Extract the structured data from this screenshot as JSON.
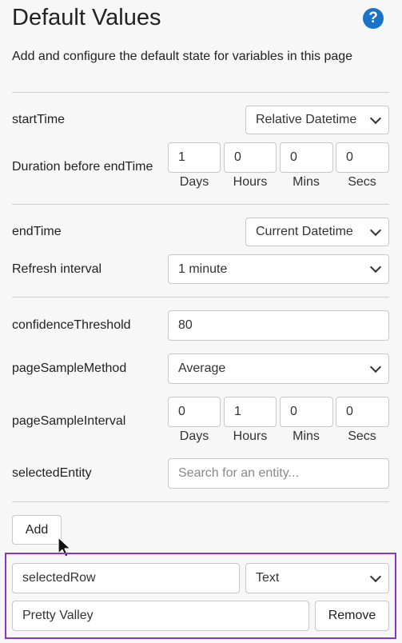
{
  "header": {
    "title": "Default Values",
    "description": "Add and configure the default state for variables in this page"
  },
  "start": {
    "label": "startTime",
    "type_value": "Relative Datetime",
    "duration_label": "Duration before endTime",
    "days": "1",
    "hours": "0",
    "mins": "0",
    "secs": "0"
  },
  "end": {
    "label": "endTime",
    "type_value": "Current Datetime",
    "refresh_label": "Refresh interval",
    "refresh_value": "1 minute"
  },
  "confidence": {
    "label": "confidenceThreshold",
    "value": "80"
  },
  "sample_method": {
    "label": "pageSampleMethod",
    "value": "Average"
  },
  "sample_interval": {
    "label": "pageSampleInterval",
    "days": "0",
    "hours": "1",
    "mins": "0",
    "secs": "0"
  },
  "entity": {
    "label": "selectedEntity",
    "placeholder": "Search for an entity..."
  },
  "units": {
    "days": "Days",
    "hours": "Hours",
    "mins": "Mins",
    "secs": "Secs"
  },
  "add_label": "Add",
  "new_var": {
    "name": "selectedRow",
    "type_value": "Text",
    "value": "Pretty Valley",
    "remove_label": "Remove"
  },
  "icons": {
    "help": "help-circle-icon",
    "cursor": "mouse-pointer-icon"
  },
  "colors": {
    "accent": "#1a73c9",
    "highlight": "#8a35c9"
  }
}
